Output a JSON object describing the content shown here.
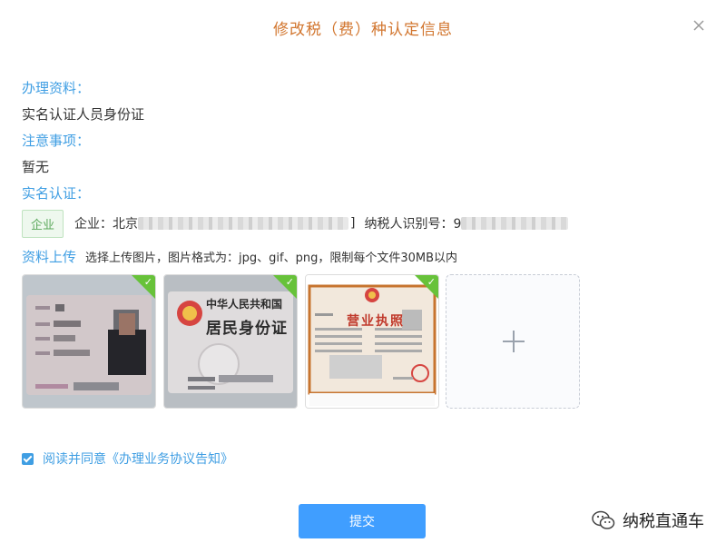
{
  "dialog": {
    "title": "修改税（费）种认定信息"
  },
  "sections": {
    "materials_label": "办理资料：",
    "materials_value": "实名认证人员身份证",
    "notes_label": "注意事项：",
    "notes_value": "暂无",
    "realname_label": "实名认证："
  },
  "corp": {
    "badge": "企业",
    "company_prefix": "企业：北京",
    "company_suffix": "]",
    "taxid_prefix": "纳税人识别号：9"
  },
  "upload": {
    "label": "资料上传",
    "hint": "选择上传图片，图片格式为：jpg、gif、png，限制每个文件30MB以内",
    "images": [
      {
        "name": "id-card-back",
        "check": "✓"
      },
      {
        "name": "id-card-front",
        "check": "✓",
        "header": "中华人民共和国",
        "title": "居民身份证"
      },
      {
        "name": "business-license",
        "check": "✓",
        "title": "营业执照"
      }
    ]
  },
  "agree": {
    "text": "阅读并同意《办理业务协议告知》"
  },
  "submit_label": "提交",
  "watermark": "纳税直通车"
}
